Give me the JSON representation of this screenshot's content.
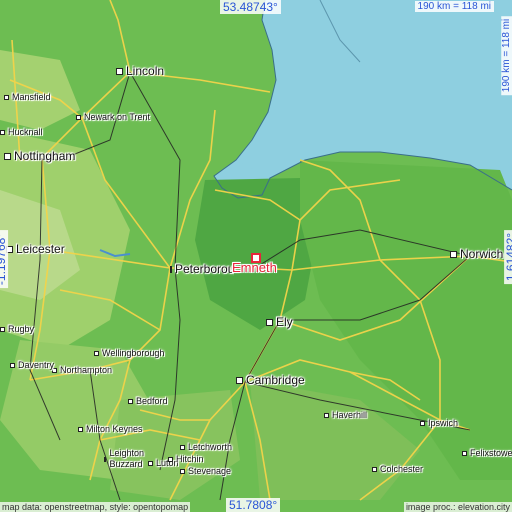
{
  "map": {
    "colors": {
      "sea": "#8ecfe0",
      "lowland": "#5cb34a",
      "midland": "#7bc35a",
      "upland": "#b3d77a",
      "highland": "#d7c59a",
      "road": "#f2d44a",
      "rail": "#222222",
      "focus": "#e8243b",
      "coord": "#2a55d6"
    },
    "focus": {
      "name": "Emneth"
    },
    "coordinates": {
      "top": "53.48743°",
      "bottom": "51.7808°",
      "left": "-1.19768°",
      "right": "1.61482°"
    },
    "scale": {
      "horizontal": "190 km = 118 mi",
      "vertical": "190 km = 118 mi"
    },
    "credits": {
      "left": "map data: openstreetmap, style: opentopomap",
      "right": "image proc.: elevation.city"
    },
    "cities": [
      {
        "name": "Lincoln"
      },
      {
        "name": "Mansfield"
      },
      {
        "name": "Newark on Trent"
      },
      {
        "name": "Hucknall"
      },
      {
        "name": "Nottingham"
      },
      {
        "name": "Leicester"
      },
      {
        "name": "Peterborough"
      },
      {
        "name": "Ely"
      },
      {
        "name": "Norwich"
      },
      {
        "name": "Wellingborough"
      },
      {
        "name": "Northampton"
      },
      {
        "name": "Daventry"
      },
      {
        "name": "Rugby"
      },
      {
        "name": "Bedford"
      },
      {
        "name": "Cambridge"
      },
      {
        "name": "Haverhill"
      },
      {
        "name": "Ipswich"
      },
      {
        "name": "Felixstowe"
      },
      {
        "name": "Colchester"
      },
      {
        "name": "Milton Keynes"
      },
      {
        "name": "Leighton Buzzard"
      },
      {
        "name": "Luton"
      },
      {
        "name": "Letchworth"
      },
      {
        "name": "Hitchin"
      },
      {
        "name": "Stevenage"
      }
    ]
  }
}
